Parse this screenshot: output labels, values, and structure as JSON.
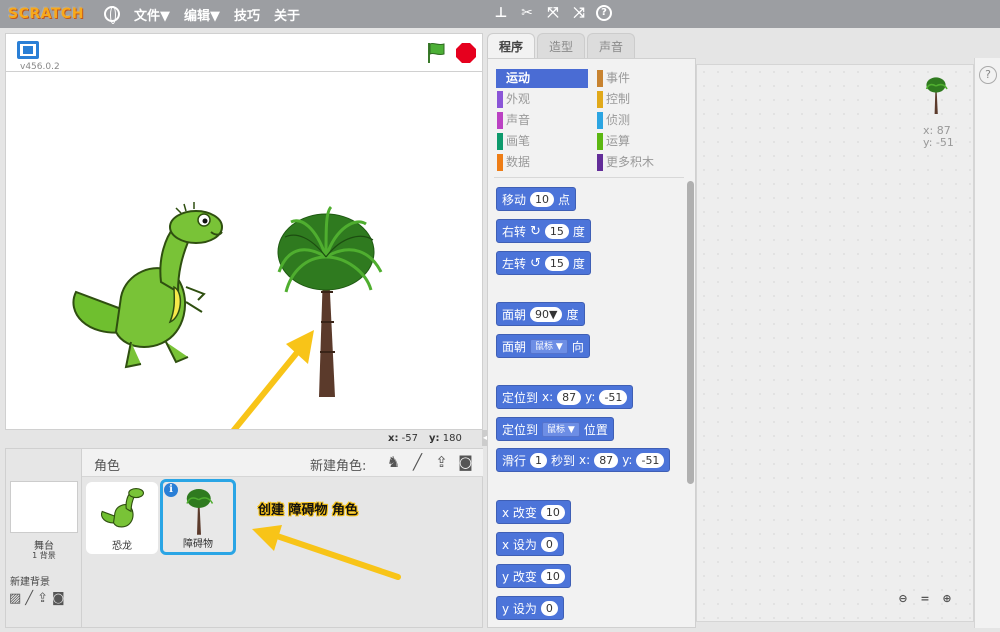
{
  "topbar": {
    "logo": "SCRATCH",
    "menus": [
      "文件▼",
      "编辑▼",
      "技巧",
      "关于"
    ],
    "tools": [
      "duplicate-icon",
      "delete-icon",
      "grow-icon",
      "shrink-icon",
      "help-icon"
    ]
  },
  "stage": {
    "version": "v456.0.2",
    "mouse_x_label": "x:",
    "mouse_x": "-57",
    "mouse_y_label": "y:",
    "mouse_y": "180"
  },
  "sprites": {
    "title": "角色",
    "new_sprite_label": "新建角色:",
    "stage_label": "舞台",
    "backdrop_count": "1 背景",
    "new_backdrop_label": "新建背景",
    "items": [
      {
        "name": "恐龙"
      },
      {
        "name": "障碍物"
      }
    ],
    "annotation": "创建 障碍物 角色"
  },
  "tabs": [
    "程序",
    "造型",
    "声音"
  ],
  "categories": [
    {
      "label": "运动",
      "color": "#4a6cd4"
    },
    {
      "label": "外观",
      "color": "#8a55d7"
    },
    {
      "label": "声音",
      "color": "#bb42c3"
    },
    {
      "label": "画笔",
      "color": "#0e9a6c"
    },
    {
      "label": "数据",
      "color": "#ee7d16"
    },
    {
      "label": "事件",
      "color": "#c88330"
    },
    {
      "label": "控制",
      "color": "#e1a91a"
    },
    {
      "label": "侦测",
      "color": "#2ca5e2"
    },
    {
      "label": "运算",
      "color": "#5cb712"
    },
    {
      "label": "更多积木",
      "color": "#632d99"
    }
  ],
  "blocks": {
    "move": {
      "label": "移动",
      "value": "10",
      "suffix": "点"
    },
    "turn_right": {
      "label": "右转",
      "value": "15",
      "suffix": "度"
    },
    "turn_left": {
      "label": "左转",
      "value": "15",
      "suffix": "度"
    },
    "point_dir": {
      "label": "面朝",
      "value": "90▼",
      "suffix": "度"
    },
    "point_towards": {
      "label": "面朝",
      "value": "鼠标 ▼",
      "suffix": "向"
    },
    "goto_xy": {
      "label": "定位到",
      "xl": "x:",
      "x": "87",
      "yl": "y:",
      "y": "-51"
    },
    "goto": {
      "label": "定位到",
      "value": "鼠标 ▼",
      "suffix": "位置"
    },
    "glide": {
      "label": "滑行",
      "secs": "1",
      "mid": "秒到",
      "xl": "x:",
      "x": "87",
      "yl": "y:",
      "y": "-51"
    },
    "change_x": {
      "label": "x 改变",
      "value": "10"
    },
    "set_x": {
      "label": "x 设为",
      "value": "0"
    },
    "change_y": {
      "label": "y 改变",
      "value": "10"
    },
    "set_y": {
      "label": "y 设为",
      "value": "0"
    }
  },
  "scripts": {
    "x_label": "x:",
    "x": "87",
    "y_label": "y:",
    "y": "-51",
    "help": "?"
  }
}
